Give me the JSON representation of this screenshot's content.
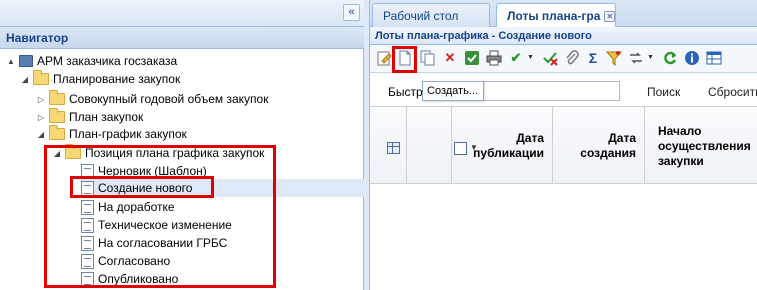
{
  "navigator": {
    "collapse_glyph": "«",
    "title": "Навигатор",
    "nodes": [
      {
        "label": "АРМ заказчика госзаказа",
        "icon": "workstation-icon",
        "toggle": "▲"
      },
      {
        "label": "Планирование закупок",
        "icon": "folder-icon",
        "toggle": "◢"
      },
      {
        "label": "Совокупный годовой объем закупок",
        "icon": "folder-icon",
        "toggle": "▷"
      },
      {
        "label": "План закупок",
        "icon": "folder-icon",
        "toggle": "▷"
      },
      {
        "label": "План-график закупок",
        "icon": "folder-icon",
        "toggle": "◢"
      },
      {
        "label": "Позиция плана графика закупок",
        "icon": "folder-icon",
        "toggle": "◢"
      },
      {
        "label": "Черновик (Шаблон)",
        "icon": "document-icon"
      },
      {
        "label": "Создание нового",
        "icon": "document-icon",
        "selected": true
      },
      {
        "label": "На доработке",
        "icon": "document-icon"
      },
      {
        "label": "Техническое изменение",
        "icon": "document-icon"
      },
      {
        "label": "На согласовании ГРБС",
        "icon": "document-icon"
      },
      {
        "label": "Согласовано",
        "icon": "document-icon"
      },
      {
        "label": "Опубликовано",
        "icon": "document-icon"
      }
    ]
  },
  "tabs": [
    {
      "label": "Рабочий стол"
    },
    {
      "label": "Лоты плана-гра",
      "active": true,
      "close_glyph": "✕"
    }
  ],
  "panel": {
    "title": "Лоты плана-графика - Создание нового",
    "toolbar": {
      "tooltip": "Создать..."
    },
    "search": {
      "quick_label": "Быстр",
      "value": "",
      "search_button": "Поиск",
      "reset_button": "Сбросить"
    },
    "grid": {
      "columns": [
        {
          "label": "Дата публикации"
        },
        {
          "label": "Дата создания"
        },
        {
          "label": "Начало осуществления закупки"
        }
      ]
    }
  },
  "colors": {
    "accent": "#15428b",
    "highlight": "#e00000",
    "selected_row": "#dfe8f6"
  }
}
